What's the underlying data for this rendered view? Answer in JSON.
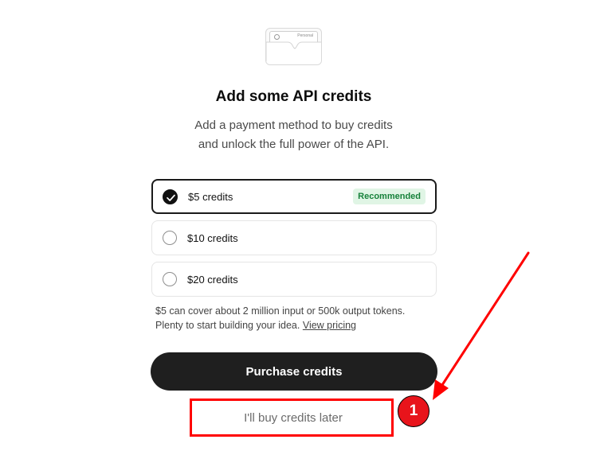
{
  "card_illustration": {
    "tag": "Personal"
  },
  "header": {
    "title": "Add some API credits",
    "subtitle_line1": "Add a payment method to buy credits",
    "subtitle_line2": "and unlock the full power of the API."
  },
  "options": [
    {
      "label": "$5 credits",
      "selected": true,
      "badge": "Recommended"
    },
    {
      "label": "$10 credits",
      "selected": false
    },
    {
      "label": "$20 credits",
      "selected": false
    }
  ],
  "note": {
    "line1": "$5 can cover about 2 million input or 500k output tokens.",
    "line2": "Plenty to start building your idea.",
    "link": "View pricing"
  },
  "buttons": {
    "purchase": "Purchase credits",
    "later": "I'll buy credits later"
  },
  "annotation": {
    "step": "1",
    "color": "#ff0000"
  },
  "colors": {
    "badge_bg": "#e0f5e5",
    "badge_text": "#16813a",
    "primary_button": "#1f1f1f"
  }
}
